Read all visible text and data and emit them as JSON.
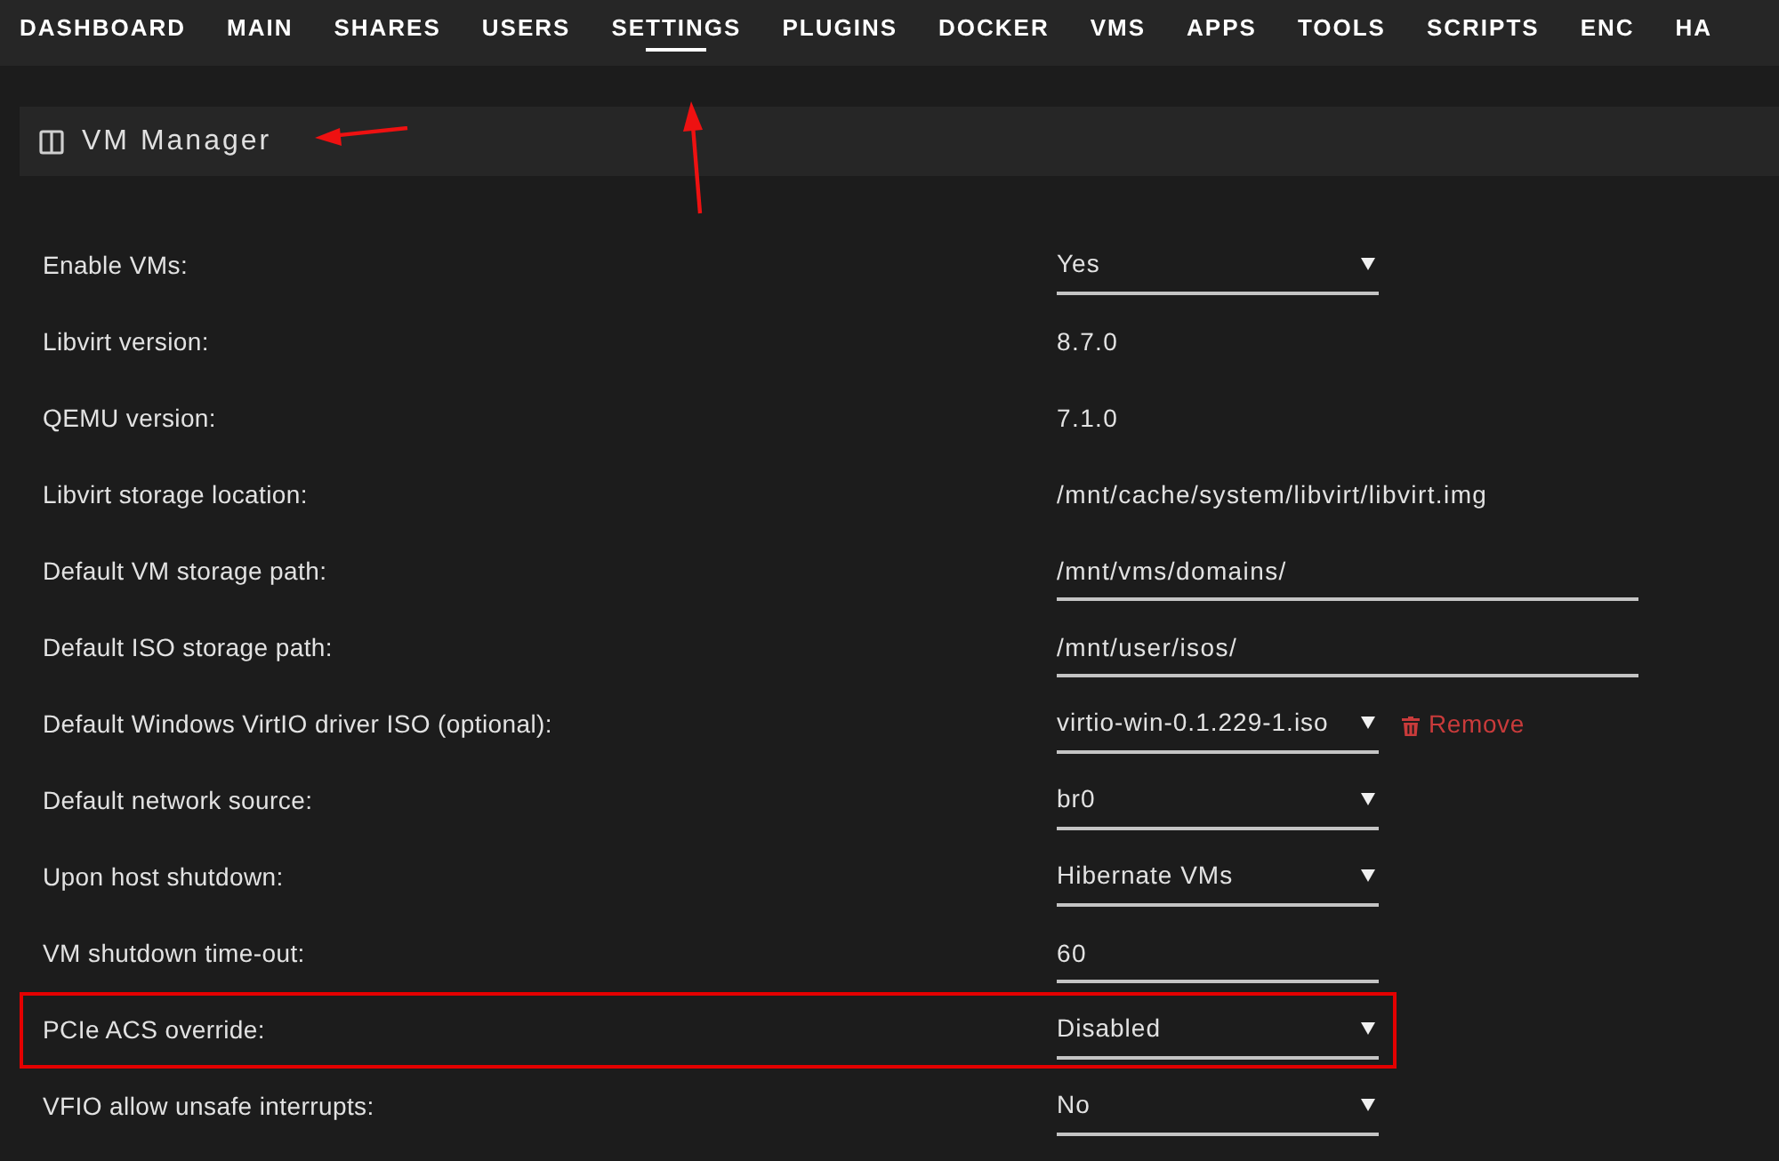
{
  "nav": {
    "tabs": [
      {
        "label": "DASHBOARD",
        "selected": false,
        "annotated": false
      },
      {
        "label": "MAIN",
        "selected": false,
        "annotated": false
      },
      {
        "label": "SHARES",
        "selected": false,
        "annotated": false
      },
      {
        "label": "USERS",
        "selected": false,
        "annotated": false
      },
      {
        "label": "SETTINGS",
        "selected": true,
        "annotated": true
      },
      {
        "label": "PLUGINS",
        "selected": false,
        "annotated": false
      },
      {
        "label": "DOCKER",
        "selected": false,
        "annotated": false
      },
      {
        "label": "VMS",
        "selected": false,
        "annotated": false
      },
      {
        "label": "APPS",
        "selected": false,
        "annotated": false
      },
      {
        "label": "TOOLS",
        "selected": false,
        "annotated": false
      },
      {
        "label": "SCRIPTS",
        "selected": false,
        "annotated": false
      },
      {
        "label": "ENC",
        "selected": false,
        "annotated": false
      },
      {
        "label": "HA",
        "selected": false,
        "annotated": false
      }
    ]
  },
  "panel": {
    "title": "VM Manager",
    "annotated": true
  },
  "settings": [
    {
      "label": "Enable VMs:",
      "kind": "select",
      "value": "Yes",
      "highlighted": false
    },
    {
      "label": "Libvirt version:",
      "kind": "text",
      "value": "8.7.0",
      "highlighted": false
    },
    {
      "label": "QEMU version:",
      "kind": "text",
      "value": "7.1.0",
      "highlighted": false
    },
    {
      "label": "Libvirt storage location:",
      "kind": "text",
      "value": "/mnt/cache/system/libvirt/libvirt.img",
      "highlighted": false
    },
    {
      "label": "Default VM storage path:",
      "kind": "path",
      "value": "/mnt/vms/domains/",
      "highlighted": false
    },
    {
      "label": "Default ISO storage path:",
      "kind": "path",
      "value": "/mnt/user/isos/",
      "highlighted": false
    },
    {
      "label": "Default Windows VirtIO driver ISO (optional):",
      "kind": "select",
      "value": "virtio-win-0.1.229-1.iso",
      "action": "Remove",
      "highlighted": false
    },
    {
      "label": "Default network source:",
      "kind": "select",
      "value": "br0",
      "highlighted": false
    },
    {
      "label": "Upon host shutdown:",
      "kind": "select",
      "value": "Hibernate VMs",
      "highlighted": false
    },
    {
      "label": "VM shutdown time-out:",
      "kind": "number",
      "value": "60",
      "highlighted": false
    },
    {
      "label": "PCIe ACS override:",
      "kind": "select",
      "value": "Disabled",
      "highlighted": true
    },
    {
      "label": "VFIO allow unsafe interrupts:",
      "kind": "select",
      "value": "No",
      "highlighted": false
    }
  ]
}
